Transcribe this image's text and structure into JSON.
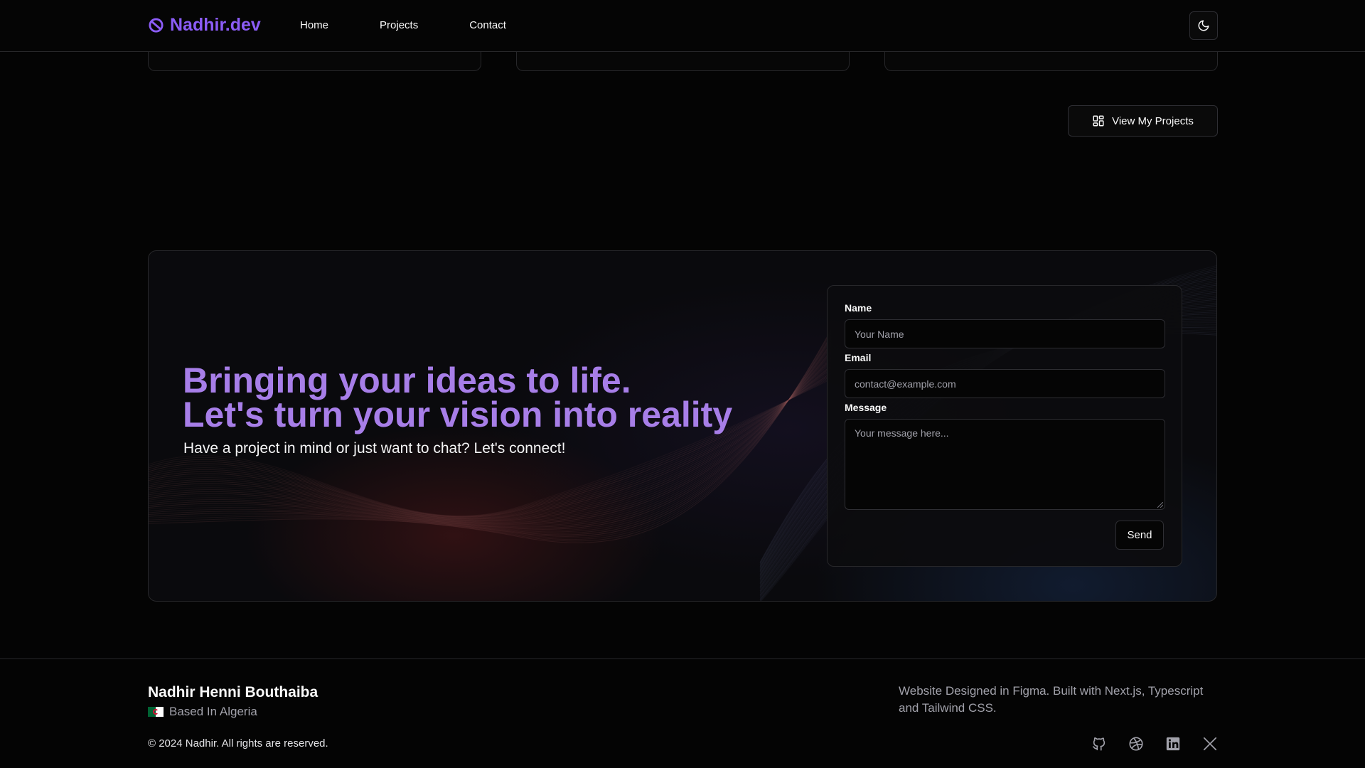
{
  "header": {
    "logo_text": "Nadhir.dev",
    "nav": [
      {
        "label": "Home"
      },
      {
        "label": "Projects"
      },
      {
        "label": "Contact"
      }
    ],
    "theme_toggle_icon": "moon-icon"
  },
  "projects": {
    "view_button_label": "View My Projects",
    "view_button_icon": "grid-icon"
  },
  "contact": {
    "headline_line1": "Bringing your ideas to life.",
    "headline_line2": "Let's turn your vision into reality",
    "subline": "Have a project in mind or just want to chat? Let's connect!",
    "form": {
      "name_label": "Name",
      "name_placeholder": "Your Name",
      "email_label": "Email",
      "email_placeholder": "contact@example.com",
      "message_label": "Message",
      "message_placeholder": "Your message here...",
      "send_label": "Send"
    }
  },
  "footer": {
    "name": "Nadhir Henni Bouthaiba",
    "location": "Based In Algeria",
    "copyright": "© 2024 Nadhir. All rights are reserved.",
    "built_with": "Website Designed in Figma. Built with Next.js, Typescript and Tailwind CSS.",
    "socials": [
      "github-icon",
      "dribbble-icon",
      "linkedin-icon",
      "x-icon"
    ]
  },
  "colors": {
    "accent": "#a77ee8",
    "logo": "#8b5cf6",
    "background": "#040404"
  }
}
